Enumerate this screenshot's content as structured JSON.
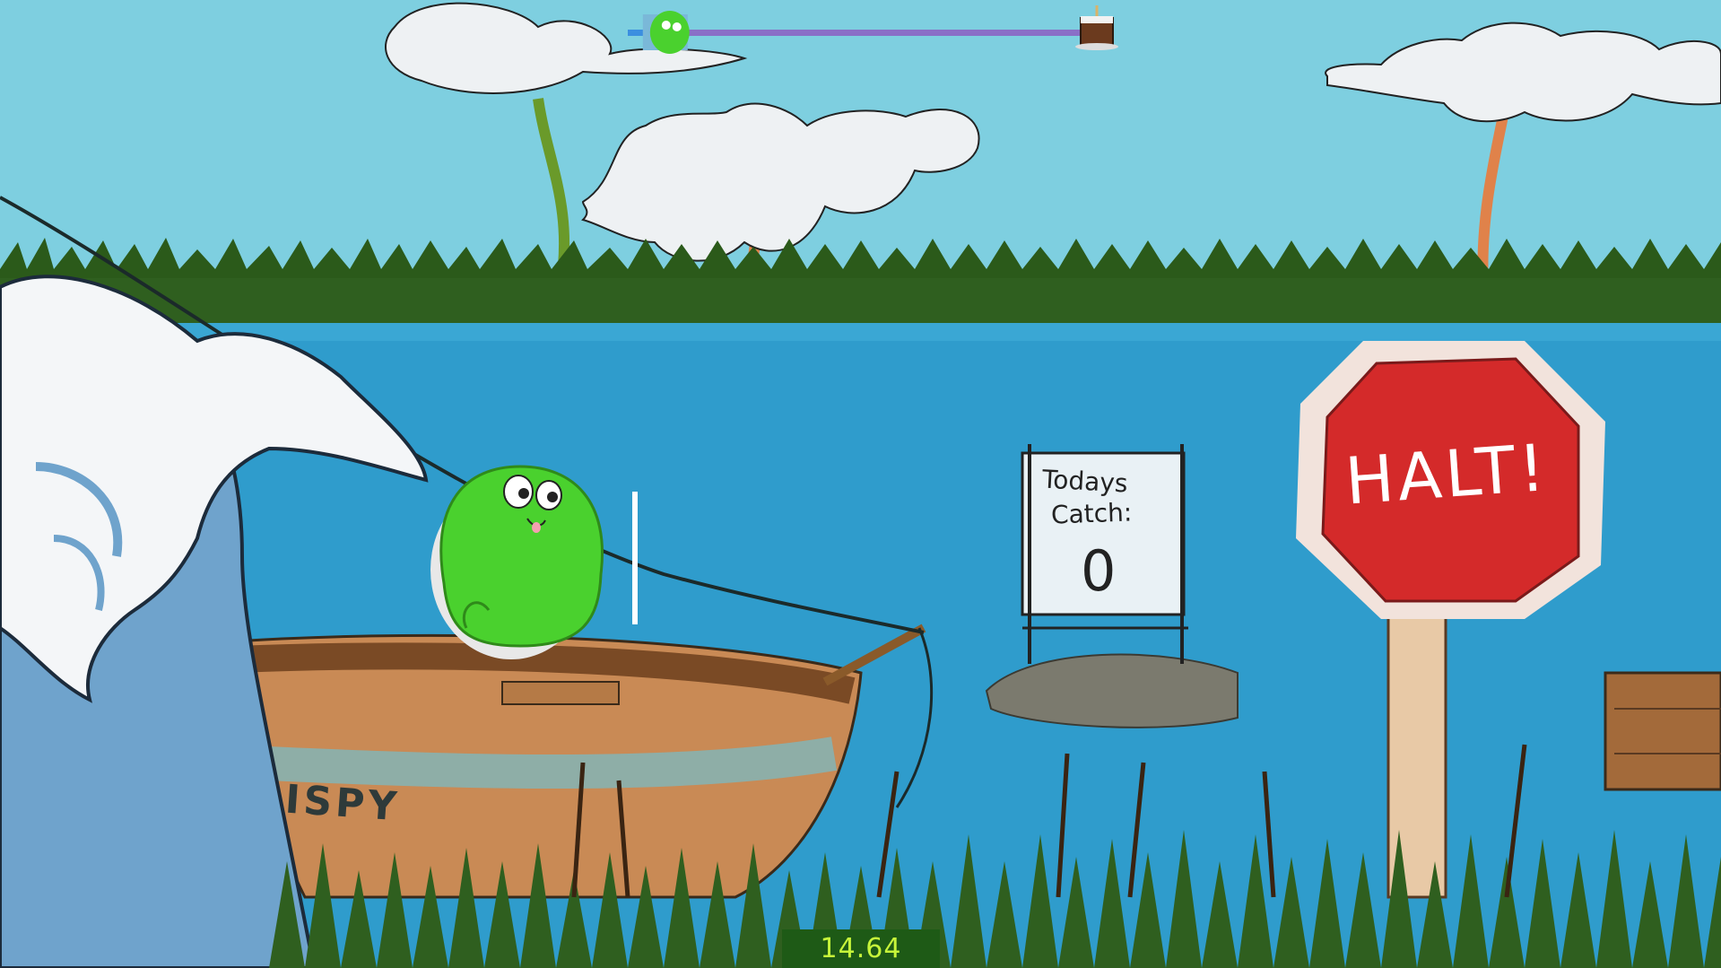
{
  "hud": {
    "timer": "14.64",
    "progress_fraction": 0.09,
    "colors": {
      "track": "#8a6fc7",
      "fill": "#3b8fe0",
      "timer_bg": "#1e5a16",
      "timer_text": "#c7f53a"
    }
  },
  "scoreboard": {
    "line1": "Todays",
    "line2": "Catch:",
    "count": "0"
  },
  "halt_sign": {
    "text": "HALT!"
  },
  "boat": {
    "name": "ISPY"
  },
  "player": {
    "icon": "green-frog-icon"
  },
  "goal": {
    "icon": "cake-icon"
  },
  "colors": {
    "sky": "#7ecfe0",
    "water": "#2f9ccc",
    "grass": "#2f5f1f",
    "halt_red": "#d42a2a"
  }
}
